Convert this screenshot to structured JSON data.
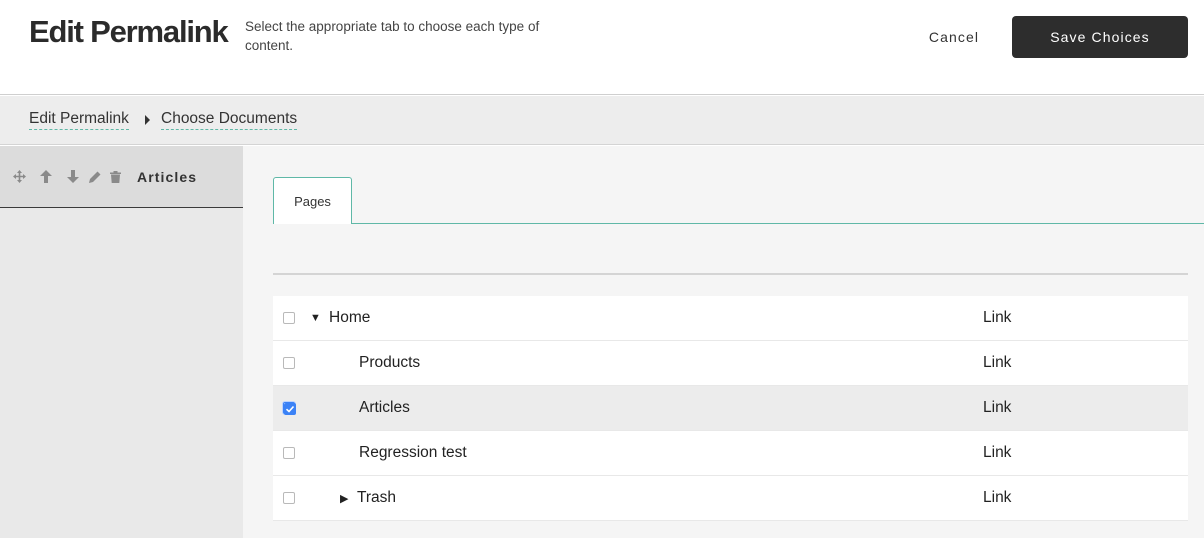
{
  "header": {
    "title": "Edit Permalink",
    "description": "Select the appropriate tab to choose each type of content.",
    "cancel_label": "Cancel",
    "save_label": "Save Choices"
  },
  "breadcrumb": {
    "items": [
      "Edit Permalink",
      "Choose Documents"
    ]
  },
  "left_panel": {
    "item_label": "Articles",
    "controls": [
      "move-icon",
      "arrow-up-icon",
      "arrow-down-icon",
      "pencil-icon",
      "trash-icon"
    ]
  },
  "tabs": [
    {
      "label": "Pages",
      "active": true
    }
  ],
  "tree": {
    "rows": [
      {
        "label": "Home",
        "link": "Link",
        "checked": false,
        "expanded": true,
        "has_children": true,
        "depth": 0
      },
      {
        "label": "Products",
        "link": "Link",
        "checked": false,
        "has_children": false,
        "depth": 1
      },
      {
        "label": "Articles",
        "link": "Link",
        "checked": true,
        "has_children": false,
        "depth": 1
      },
      {
        "label": "Regression test",
        "link": "Link",
        "checked": false,
        "has_children": false,
        "depth": 1
      },
      {
        "label": "Trash",
        "link": "Link",
        "checked": false,
        "expanded": false,
        "has_children": true,
        "depth": 1
      }
    ]
  },
  "colors": {
    "accent": "#5fb8a7",
    "primary_button": "#2d2d2d",
    "checkbox_checked": "#3b82f6"
  }
}
